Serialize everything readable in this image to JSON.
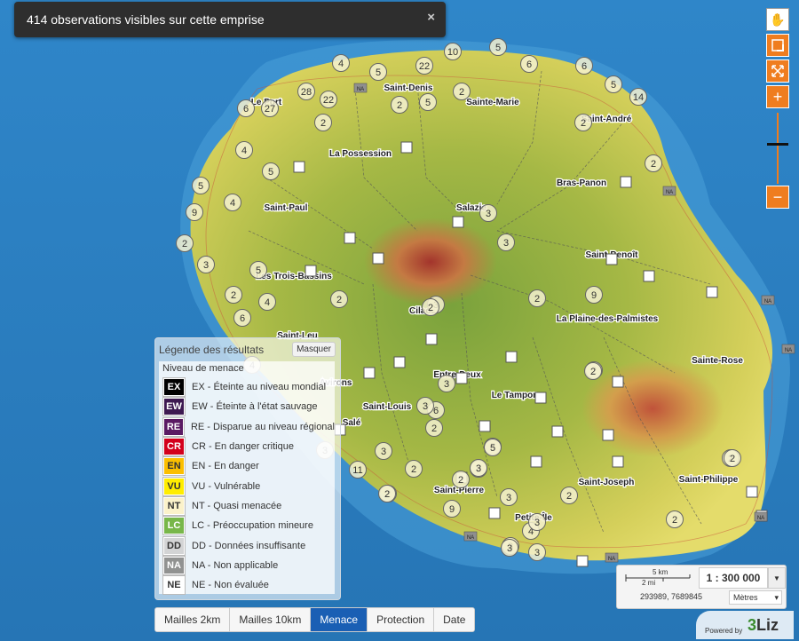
{
  "toast": {
    "text": "414 observations visibles sur cette emprise",
    "close": "×"
  },
  "tools": {
    "hand": "✋",
    "box": "◻",
    "extent": "⤢",
    "zoom_in": "+",
    "zoom_out": "−"
  },
  "places": [
    {
      "name": "Le Port"
    },
    {
      "name": "Saint-Denis"
    },
    {
      "name": "Sainte-Marie"
    },
    {
      "name": "Saint-André"
    },
    {
      "name": "La Possession"
    },
    {
      "name": "Bras-Panon"
    },
    {
      "name": "Saint-Paul"
    },
    {
      "name": "Salazie"
    },
    {
      "name": "Saint-Benoît"
    },
    {
      "name": "Les Trois-Bassins"
    },
    {
      "name": "Cilaos"
    },
    {
      "name": "La Plaine-des-Palmistes"
    },
    {
      "name": "Saint-Leu"
    },
    {
      "name": "Sainte-Rose"
    },
    {
      "name": "Avirons"
    },
    {
      "name": "Entre-Deux"
    },
    {
      "name": "Le Tampon"
    },
    {
      "name": "Saint-Louis"
    },
    {
      "name": "Salé"
    },
    {
      "name": "Saint-Pierre"
    },
    {
      "name": "Saint-Joseph"
    },
    {
      "name": "Saint-Philippe"
    },
    {
      "name": "Petite-Île"
    }
  ],
  "clusters": [
    "4",
    "5",
    "22",
    "10",
    "5",
    "6",
    "6",
    "5",
    "14",
    "2",
    "2",
    "28",
    "27",
    "22",
    "6",
    "2",
    "5",
    "2",
    "2",
    "5",
    "4",
    "4",
    "5",
    "3",
    "9",
    "3",
    "2",
    "5",
    "3",
    "2",
    "4",
    "2",
    "2",
    "3",
    "6",
    "9",
    "6",
    "2",
    "3",
    "4",
    "3",
    "2",
    "3",
    "11",
    "2",
    "5",
    "3",
    "2",
    "2",
    "3",
    "2",
    "3",
    "9",
    "2",
    "3",
    "4",
    "2",
    "3",
    "2",
    "2",
    "3",
    "5",
    "2",
    "3",
    "3",
    "2"
  ],
  "na_label": "NA",
  "legend": {
    "title": "Légende des résultats",
    "hide": "Masquer",
    "category": "Niveau de menace",
    "items": [
      {
        "code": "EX",
        "label": "EX - Éteinte au niveau mondial",
        "bg": "#000000",
        "fg": "#ffffff"
      },
      {
        "code": "EW",
        "label": "EW - Éteinte à l'état sauvage",
        "bg": "#3d1951",
        "fg": "#ffffff"
      },
      {
        "code": "RE",
        "label": "RE - Disparue au niveau régional",
        "bg": "#5a1a63",
        "fg": "#ffffff"
      },
      {
        "code": "CR",
        "label": "CR - En danger critique",
        "bg": "#d3001b",
        "fg": "#ffffff"
      },
      {
        "code": "EN",
        "label": "EN - En danger",
        "bg": "#fbbf00",
        "fg": "#333333"
      },
      {
        "code": "VU",
        "label": "VU - Vulnérable",
        "bg": "#ffed00",
        "fg": "#333333"
      },
      {
        "code": "NT",
        "label": "NT - Quasi menacée",
        "bg": "#fbf2ca",
        "fg": "#333333"
      },
      {
        "code": "LC",
        "label": "LC - Préoccupation mineure",
        "bg": "#78b74a",
        "fg": "#ffffff"
      },
      {
        "code": "DD",
        "label": "DD - Données insuffisante",
        "bg": "#d3d4d5",
        "fg": "#333333"
      },
      {
        "code": "NA",
        "label": "NA - Non applicable",
        "bg": "#919291",
        "fg": "#ffffff"
      },
      {
        "code": "NE",
        "label": "NE - Non évaluée",
        "bg": "#ffffff",
        "fg": "#333333"
      }
    ]
  },
  "tabs": [
    "Mailles 2km",
    "Mailles 10km",
    "Menace",
    "Protection",
    "Date"
  ],
  "active_tab": "Menace",
  "scale": {
    "km": "5 km",
    "mi": "2 mi",
    "ratio": "1 : 300 000",
    "coords": "293989, 7689845",
    "units": "Mètres"
  },
  "powered": {
    "text": "Powered by",
    "logo_a": "3",
    "logo_b": "Liz"
  },
  "colors": {
    "accent": "#ef7d1f",
    "active_tab": "#1a5fb4",
    "sea": "#2a7fc0"
  }
}
